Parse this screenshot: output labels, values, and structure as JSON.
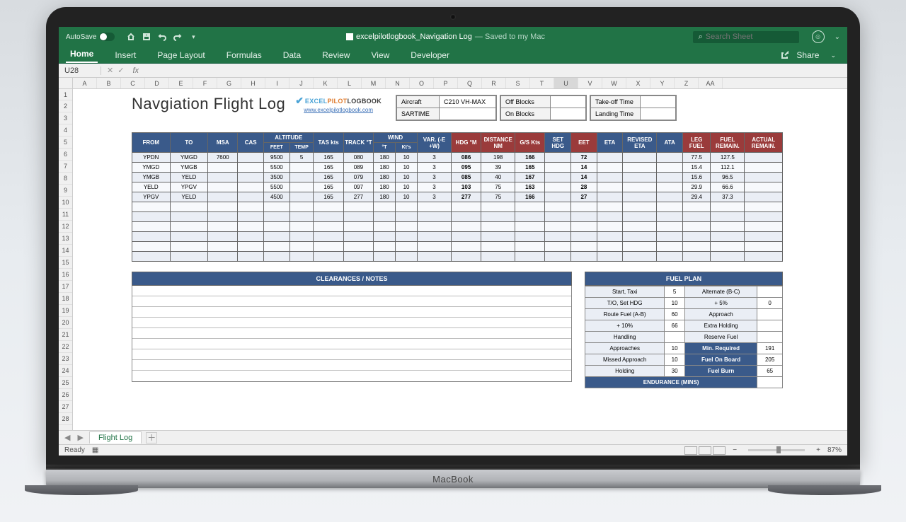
{
  "window": {
    "autosave_label": "AutoSave",
    "doc_title": "excelpilotlogbook_Navigation Log",
    "save_status": "— Saved to my Mac",
    "search_placeholder": "Search Sheet"
  },
  "ribbon": {
    "tabs": [
      "Home",
      "Insert",
      "Page Layout",
      "Formulas",
      "Data",
      "Review",
      "View",
      "Developer"
    ],
    "share": "Share"
  },
  "namebox": {
    "cell": "U28",
    "fx": "fx"
  },
  "columns": [
    "A",
    "B",
    "C",
    "D",
    "E",
    "F",
    "G",
    "H",
    "I",
    "J",
    "K",
    "L",
    "M",
    "N",
    "O",
    "P",
    "Q",
    "R",
    "S",
    "T",
    "U",
    "V",
    "W",
    "X",
    "Y",
    "Z",
    "AA"
  ],
  "rows_shown": 28,
  "title": "Navgiation Flight Log",
  "logo": {
    "brand_excel": "EXCEL",
    "brand_pilot": "PILOT",
    "brand_logbook": "LOGBOOK",
    "link": "www.excelpilotlogbook.com"
  },
  "info": {
    "box1": [
      [
        "Aircraft",
        "C210 VH-MAX"
      ],
      [
        "SARTIME",
        ""
      ]
    ],
    "box2": [
      [
        "Off Blocks",
        ""
      ],
      [
        "On Blocks",
        ""
      ]
    ],
    "box3": [
      [
        "Take-off Time",
        ""
      ],
      [
        "Landing Time",
        ""
      ]
    ]
  },
  "nav_headers_top": [
    "FROM",
    "TO",
    "MSA",
    "CAS",
    "ALTITUDE",
    "TAS kts",
    "TRACK °T",
    "WIND",
    "VAR. (-E +W)",
    "HDG °M",
    "DISTANCE NM",
    "G/S Kts",
    "SET HDG",
    "EET",
    "ETA",
    "REVISED ETA",
    "ATA",
    "LEG FUEL",
    "FUEL REMAIN.",
    "ACTUAL REMAIN."
  ],
  "nav_headers_sub_alt": [
    "FEET",
    "TEMP"
  ],
  "nav_headers_sub_wind": [
    "°T",
    "Kt's"
  ],
  "nav_rows": [
    {
      "from": "YPDN",
      "to": "YMGD",
      "msa": "7600",
      "cas": "",
      "feet": "9500",
      "temp": "5",
      "tas": "165",
      "track": "080",
      "wdir": "180",
      "wkts": "10",
      "var": "3",
      "hdg": "086",
      "dist": "198",
      "gs": "166",
      "set": "",
      "eet": "72",
      "eta": "",
      "reta": "",
      "ata": "",
      "leg": "77.5",
      "remain": "127.5",
      "actual": ""
    },
    {
      "from": "YMGD",
      "to": "YMGB",
      "msa": "",
      "cas": "",
      "feet": "5500",
      "temp": "",
      "tas": "165",
      "track": "089",
      "wdir": "180",
      "wkts": "10",
      "var": "3",
      "hdg": "095",
      "dist": "39",
      "gs": "165",
      "set": "",
      "eet": "14",
      "eta": "",
      "reta": "",
      "ata": "",
      "leg": "15.4",
      "remain": "112.1",
      "actual": ""
    },
    {
      "from": "YMGB",
      "to": "YELD",
      "msa": "",
      "cas": "",
      "feet": "3500",
      "temp": "",
      "tas": "165",
      "track": "079",
      "wdir": "180",
      "wkts": "10",
      "var": "3",
      "hdg": "085",
      "dist": "40",
      "gs": "167",
      "set": "",
      "eet": "14",
      "eta": "",
      "reta": "",
      "ata": "",
      "leg": "15.6",
      "remain": "96.5",
      "actual": ""
    },
    {
      "from": "YELD",
      "to": "YPGV",
      "msa": "",
      "cas": "",
      "feet": "5500",
      "temp": "",
      "tas": "165",
      "track": "097",
      "wdir": "180",
      "wkts": "10",
      "var": "3",
      "hdg": "103",
      "dist": "75",
      "gs": "163",
      "set": "",
      "eet": "28",
      "eta": "",
      "reta": "",
      "ata": "",
      "leg": "29.9",
      "remain": "66.6",
      "actual": ""
    },
    {
      "from": "YPGV",
      "to": "YELD",
      "msa": "",
      "cas": "",
      "feet": "4500",
      "temp": "",
      "tas": "165",
      "track": "277",
      "wdir": "180",
      "wkts": "10",
      "var": "3",
      "hdg": "277",
      "dist": "75",
      "gs": "166",
      "set": "",
      "eet": "27",
      "eta": "",
      "reta": "",
      "ata": "",
      "leg": "29.4",
      "remain": "37.3",
      "actual": ""
    }
  ],
  "nav_blank_rows": 6,
  "clearances_title": "CLEARANCES  /  NOTES",
  "clearances_rows": 9,
  "fuel_plan": {
    "title": "FUEL PLAN",
    "rows": [
      [
        "Start, Taxi",
        "5",
        "Alternate (B-C)",
        ""
      ],
      [
        "T/O, Set HDG",
        "10",
        "+ 5%",
        "0"
      ],
      [
        "Route Fuel (A-B)",
        "60",
        "Approach",
        ""
      ],
      [
        "+ 10%",
        "66",
        "Extra Holding",
        ""
      ],
      [
        "Handling",
        "",
        "Reserve Fuel",
        ""
      ],
      [
        "Approaches",
        "10",
        "Min. Required",
        "191"
      ],
      [
        "Missed Approach",
        "10",
        "Fuel On Board",
        "205"
      ],
      [
        "Holding",
        "30",
        "Fuel Burn",
        "65"
      ]
    ],
    "endurance_label": "ENDURANCE (MINS)",
    "bold_right": [
      "Min. Required",
      "Fuel On Board",
      "Fuel Burn"
    ]
  },
  "sheet_tab": "Flight Log",
  "status": {
    "ready": "Ready",
    "zoom": "87%"
  }
}
